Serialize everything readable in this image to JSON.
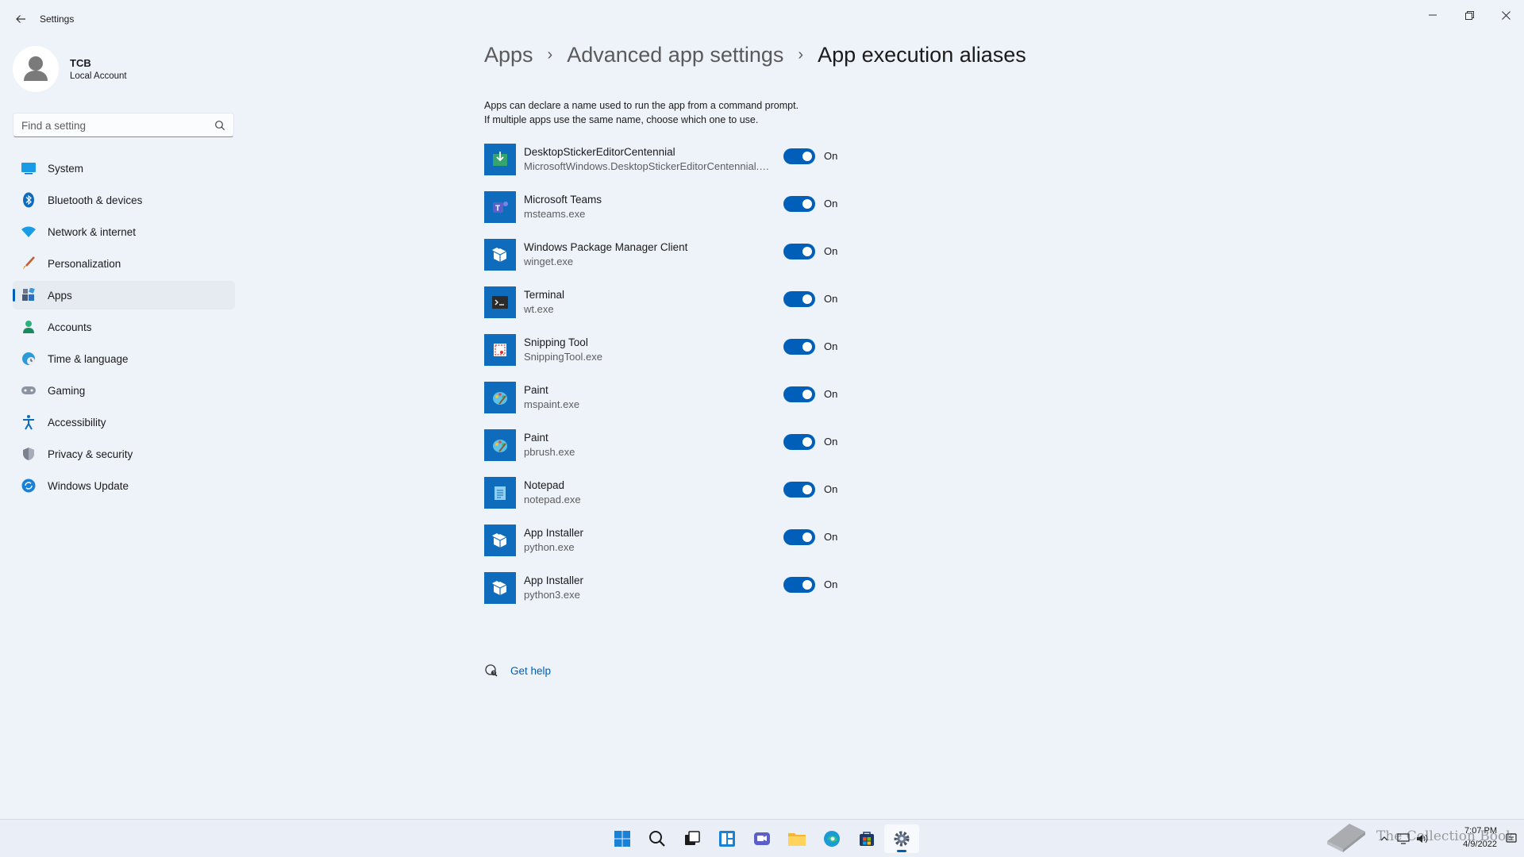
{
  "window": {
    "title": "Settings",
    "controls": [
      "minimize",
      "maximize",
      "close"
    ]
  },
  "profile": {
    "name": "TCB",
    "account_type": "Local Account"
  },
  "search": {
    "placeholder": "Find a setting"
  },
  "sidebar": {
    "items": [
      {
        "label": "System",
        "icon": "system-icon"
      },
      {
        "label": "Bluetooth & devices",
        "icon": "bluetooth-icon"
      },
      {
        "label": "Network & internet",
        "icon": "wifi-icon"
      },
      {
        "label": "Personalization",
        "icon": "brush-icon"
      },
      {
        "label": "Apps",
        "icon": "apps-icon",
        "active": true
      },
      {
        "label": "Accounts",
        "icon": "person-icon"
      },
      {
        "label": "Time & language",
        "icon": "globe-clock-icon"
      },
      {
        "label": "Gaming",
        "icon": "gamepad-icon"
      },
      {
        "label": "Accessibility",
        "icon": "accessibility-icon"
      },
      {
        "label": "Privacy & security",
        "icon": "shield-icon"
      },
      {
        "label": "Windows Update",
        "icon": "update-icon"
      }
    ]
  },
  "breadcrumb": {
    "items": [
      "Apps",
      "Advanced app settings",
      "App execution aliases"
    ],
    "separator": "›"
  },
  "description": {
    "line1": "Apps can declare a name used to run the app from a command prompt.",
    "line2": "If multiple apps use the same name, choose which one to use."
  },
  "aliases": [
    {
      "name": "DesktopStickerEditorCentennial",
      "exe": "MicrosoftWindows.DesktopStickerEditorCentennial.exe",
      "state": "On",
      "icon": "sticker-editor-icon"
    },
    {
      "name": "Microsoft Teams",
      "exe": "msteams.exe",
      "state": "On",
      "icon": "teams-icon"
    },
    {
      "name": "Windows Package Manager Client",
      "exe": "winget.exe",
      "state": "On",
      "icon": "package-icon"
    },
    {
      "name": "Terminal",
      "exe": "wt.exe",
      "state": "On",
      "icon": "terminal-icon"
    },
    {
      "name": "Snipping Tool",
      "exe": "SnippingTool.exe",
      "state": "On",
      "icon": "snipping-tool-icon"
    },
    {
      "name": "Paint",
      "exe": "mspaint.exe",
      "state": "On",
      "icon": "paint-icon"
    },
    {
      "name": "Paint",
      "exe": "pbrush.exe",
      "state": "On",
      "icon": "paint-icon"
    },
    {
      "name": "Notepad",
      "exe": "notepad.exe",
      "state": "On",
      "icon": "notepad-icon"
    },
    {
      "name": "App Installer",
      "exe": "python.exe",
      "state": "On",
      "icon": "package-icon"
    },
    {
      "name": "App Installer",
      "exe": "python3.exe",
      "state": "On",
      "icon": "package-icon"
    }
  ],
  "help": {
    "label": "Get help"
  },
  "taskbar": {
    "apps": [
      "start-icon",
      "search-icon",
      "task-view-icon",
      "widgets-icon",
      "chat-icon",
      "file-explorer-icon",
      "edge-icon",
      "store-icon",
      "settings-icon"
    ],
    "active": "settings-icon"
  },
  "tray": {
    "time": "7:07 PM",
    "date": "4/9/2022"
  },
  "watermark": {
    "text": "The Collection Book"
  },
  "colors": {
    "accent": "#005fb8",
    "background": "#eef2f9",
    "app_tile": "#0f6cbd"
  }
}
